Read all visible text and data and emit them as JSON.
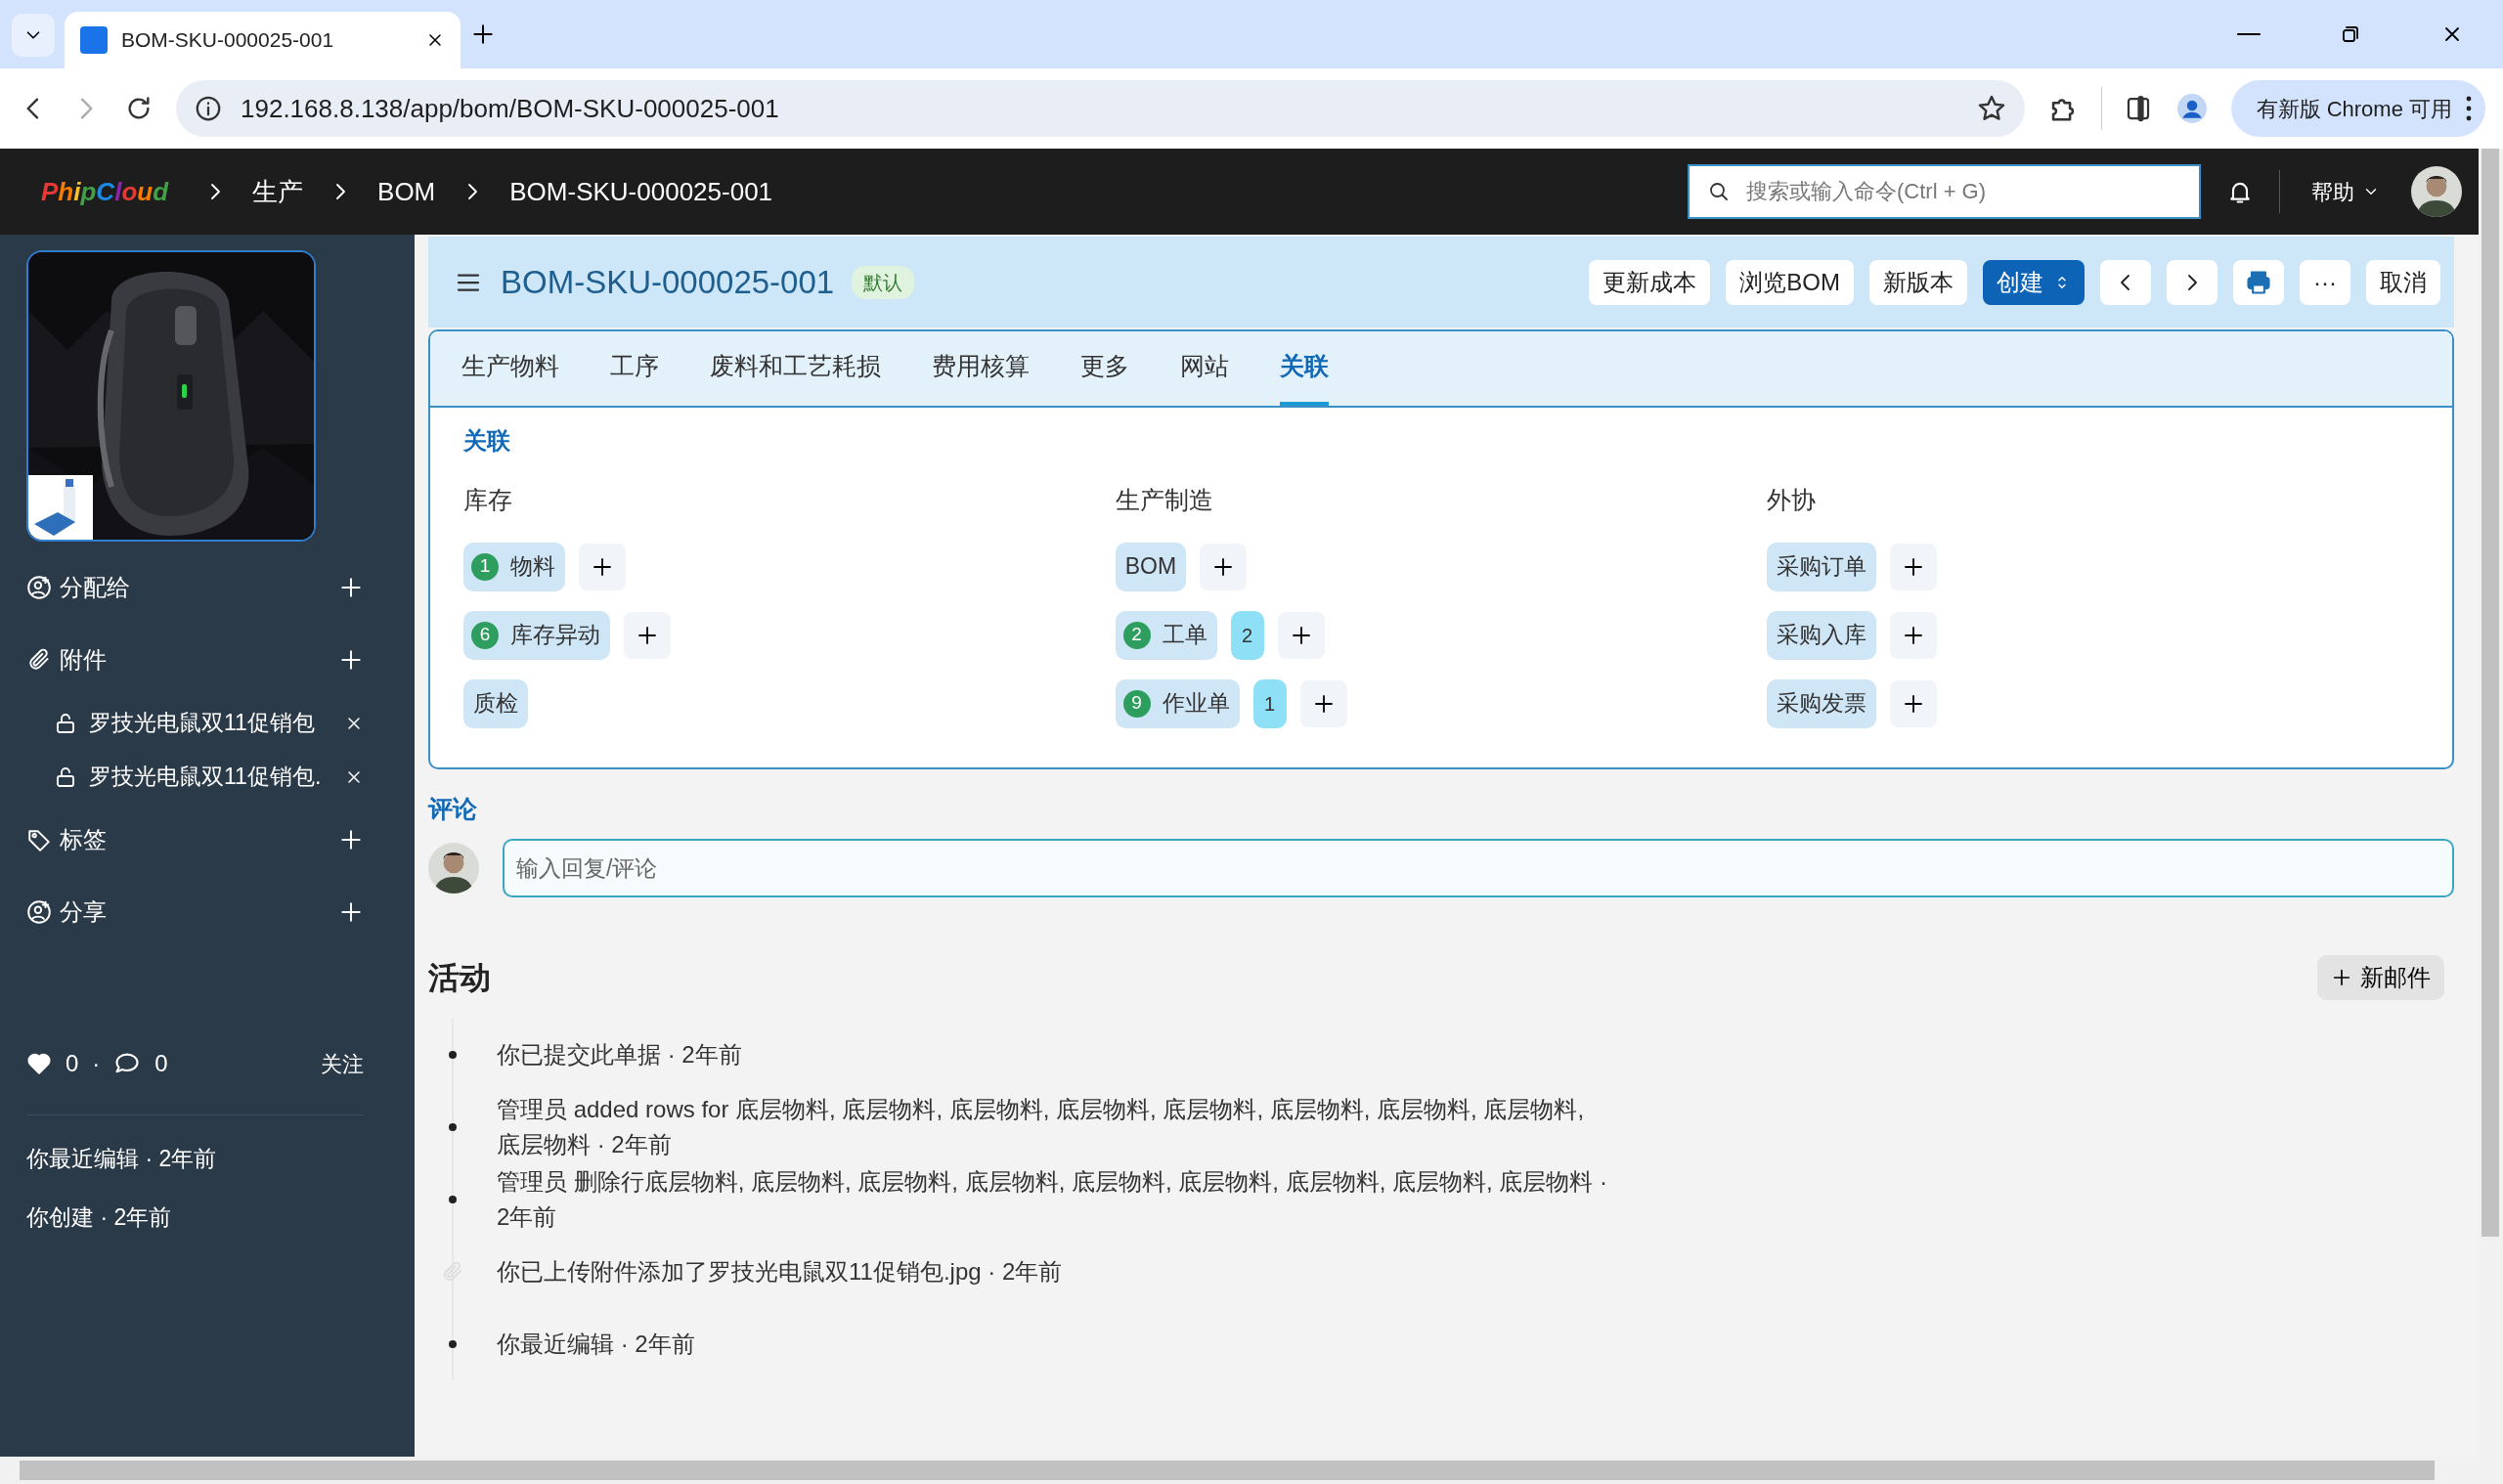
{
  "browser": {
    "tab_title": "BOM-SKU-000025-001",
    "url": "192.168.8.138/app/bom/BOM-SKU-000025-001",
    "update_button": "有新版 Chrome 可用"
  },
  "navbar": {
    "logo": "PhipCloud",
    "breadcrumbs": [
      "生产",
      "BOM",
      "BOM-SKU-000025-001"
    ],
    "search": {
      "placeholder": "搜索或输入命令(Ctrl + G)"
    },
    "help": "帮助"
  },
  "sidebar": {
    "sections": [
      {
        "kind": "assign",
        "label": "分配给"
      },
      {
        "kind": "attachments",
        "label": "附件",
        "items": [
          "罗技光电鼠双11促销包",
          "罗技光电鼠双11促销包."
        ]
      },
      {
        "kind": "tags",
        "label": "标签"
      },
      {
        "kind": "share",
        "label": "分享"
      }
    ],
    "likes": "0",
    "separator": "·",
    "comments": "0",
    "follow": "关注",
    "history": [
      "你最近编辑 · 2年前",
      "你创建 · 2年前"
    ]
  },
  "document": {
    "title": "BOM-SKU-000025-001",
    "status": "默认",
    "buttons": [
      {
        "kind": "text",
        "label": "更新成本"
      },
      {
        "kind": "text",
        "label": "浏览BOM"
      },
      {
        "kind": "text",
        "label": "新版本"
      },
      {
        "kind": "primary",
        "label": "创建"
      },
      {
        "kind": "prev"
      },
      {
        "kind": "next"
      },
      {
        "kind": "print"
      },
      {
        "kind": "text",
        "label": "···"
      },
      {
        "kind": "text",
        "label": "取消"
      }
    ]
  },
  "tabs": [
    {
      "label": "生产物料",
      "selected": false
    },
    {
      "label": "工序",
      "selected": false
    },
    {
      "label": "废料和工艺耗损",
      "selected": false
    },
    {
      "label": "费用核算",
      "selected": false
    },
    {
      "label": "更多",
      "selected": false
    },
    {
      "label": "网站",
      "selected": false
    },
    {
      "label": "关联",
      "selected": true
    }
  ],
  "connections": {
    "heading": "关联",
    "groups": [
      {
        "title": "库存",
        "items": [
          {
            "label": "物料",
            "count": "1",
            "addable": true
          },
          {
            "label": "库存异动",
            "count": "6",
            "addable": true
          },
          {
            "label": "质检",
            "addable": false
          }
        ]
      },
      {
        "title": "生产制造",
        "items": [
          {
            "label": "BOM",
            "addable": true
          },
          {
            "label": "工单",
            "count": "2",
            "open_count": "2",
            "addable": true
          },
          {
            "label": "作业单",
            "count": "9",
            "open_count": "1",
            "addable": true
          }
        ]
      },
      {
        "title": "外协",
        "items": [
          {
            "label": "采购订单",
            "addable": true
          },
          {
            "label": "采购入库",
            "addable": true
          },
          {
            "label": "采购发票",
            "addable": true
          }
        ]
      }
    ]
  },
  "comments": {
    "heading": "评论",
    "placeholder": "输入回复/评论"
  },
  "activity": {
    "heading": "活动",
    "new_email": "新邮件",
    "items": [
      {
        "kind": "event",
        "text": "你已提交此单据 · 2年前"
      },
      {
        "kind": "event",
        "text": "管理员 added rows for 底层物料, 底层物料, 底层物料, 底层物料, 底层物料, 底层物料, 底层物料, 底层物料, 底层物料 · 2年前"
      },
      {
        "kind": "event",
        "text": "管理员 删除行底层物料, 底层物料, 底层物料, 底层物料, 底层物料, 底层物料, 底层物料, 底层物料, 底层物料 · 2年前"
      },
      {
        "kind": "attachment",
        "text": "你已上传附件添加了罗技光电鼠双11促销包.jpg · 2年前"
      },
      {
        "kind": "event",
        "text": "你最近编辑 · 2年前"
      }
    ]
  }
}
